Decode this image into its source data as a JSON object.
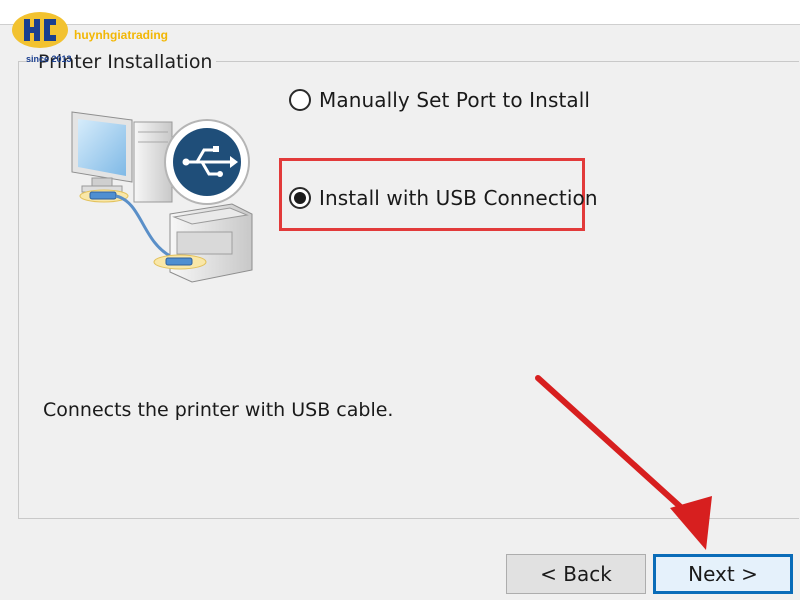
{
  "watermark": {
    "brand": "huynhgiatrading",
    "since": "since 2013",
    "icon": "brand-logo-icon",
    "color": "#f2b705"
  },
  "group": {
    "title": "Printer Installation"
  },
  "options": [
    {
      "label": "Manually Set Port to Install",
      "selected": false
    },
    {
      "label": "Install with USB Connection",
      "selected": true
    }
  ],
  "description": "Connects the printer with USB cable.",
  "buttons": {
    "back": "< Back",
    "next": "Next >"
  },
  "icons": {
    "illustration": "computer-usb-printer-icon",
    "usb": "usb-icon",
    "annotation_arrow": "red-arrow-icon"
  },
  "colors": {
    "highlight": "#e23a3a",
    "arrow": "#d71f1f",
    "focus_border": "#0a6cb8"
  }
}
